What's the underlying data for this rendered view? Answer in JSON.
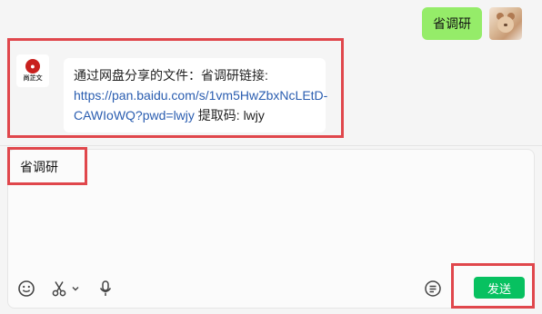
{
  "chat": {
    "outgoing_message": "省调研",
    "incoming_message": {
      "prefix": "通过网盘分享的文件：省调研链接: ",
      "link": "https://pan.baidu.com/s/1vm5HwZbxNcLEtD-CAWIoWQ?pwd=lwjy",
      "suffix": " 提取码: lwjy"
    },
    "brand_avatar_text": "尚芷文"
  },
  "composer": {
    "draft_text": "省调研",
    "send_label": "发送"
  },
  "icons": {
    "emoji": "emoji-icon",
    "scissors": "scissors-icon",
    "chevron": "chevron-down-icon",
    "mic": "microphone-icon",
    "chat_history": "chat-history-icon"
  },
  "colors": {
    "outgoing_bubble": "#95ec69",
    "send_button": "#07c160",
    "highlight_box": "#e0474c",
    "link": "#2a5db0"
  }
}
